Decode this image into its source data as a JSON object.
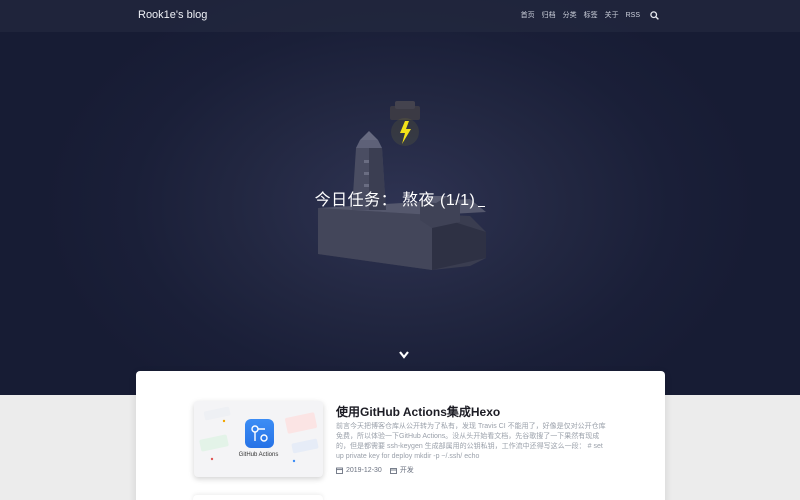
{
  "navbar": {
    "brand": "Rook1e's blog",
    "items": [
      "首页",
      "归档",
      "分类",
      "标签",
      "关于",
      "RSS"
    ],
    "search_icon": "search-icon"
  },
  "hero": {
    "title": "今日任务： 熬夜 (1/1)",
    "scroll_icon": "chevron-down-icon"
  },
  "post": {
    "title": "使用GitHub Actions集成Hexo",
    "excerpt": "前言今天把博客仓库从公开转为了私有，发现 Travis CI 不能用了，好像是仅对公开仓库免费，所以体验一下GitHub Actions。没从头开始看文档，先谷歌搜了一下果然有现成的，但是都需要 ssh-keygen 生成部属用的公钥私钥，工作流中还得写这么一段： # set up private key for deploy mkdir -p ~/.ssh/ echo",
    "date": "2019-12-30",
    "category": "开发",
    "thumb_caption": "GitHub Actions"
  },
  "colors": {
    "hero_bg": "#1b2039",
    "accent_bolt": "#f3e21a",
    "card_bg": "#ffffff",
    "page_bg": "#ececec"
  }
}
